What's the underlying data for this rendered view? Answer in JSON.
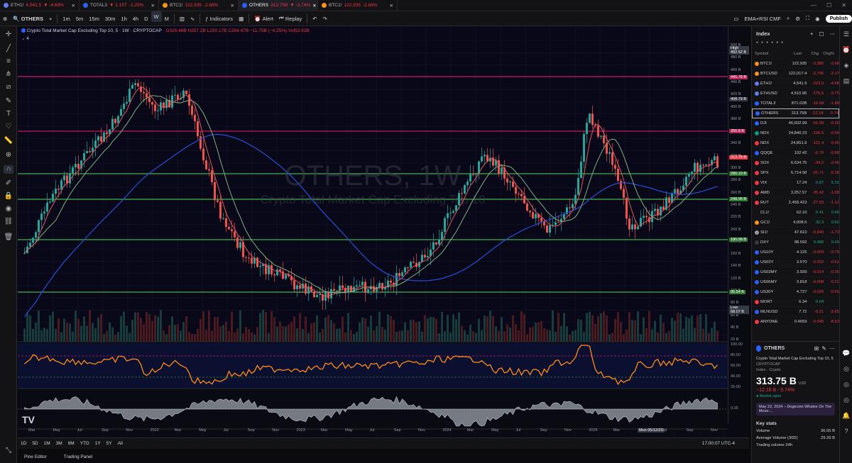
{
  "tabs": [
    {
      "symbol": "ETH1!",
      "text": "4,541.5",
      "chg": "▼ -4.68%",
      "active": false,
      "color": "#627eea"
    },
    {
      "symbol": "TOTAL3",
      "text": "▼ 1.15T",
      "chg": "-1.25%",
      "active": false,
      "color": "#2962ff"
    },
    {
      "symbol": "BTC1!",
      "text": "122,935",
      "chg": "-2.68%",
      "active": false,
      "color": "#f7931a"
    },
    {
      "symbol": "OTHERS",
      "text": "313.75B",
      "chg": "▼ -3.74%",
      "active": true,
      "color": "#2962ff"
    },
    {
      "symbol": "BTC1!",
      "text": "122,935",
      "chg": "-2.68%",
      "active": false,
      "color": "#f7931a"
    }
  ],
  "toolbar": {
    "symbol": "OTHERS",
    "intervals": [
      "1m",
      "5m",
      "15m",
      "30m",
      "1h",
      "4h",
      "D",
      "W",
      "M"
    ],
    "selected_interval": "W",
    "indicators": "Indicators",
    "alert": "Alert",
    "replay": "Replay",
    "study_label": "EMA+RSI CMF",
    "publish": "Publish"
  },
  "legend": {
    "title": "Crypto Total Market Cap Excluding Top 10, 5 · 1W · CRYPTOCAP",
    "ohlc": "O326.48B H297.2B L250.17B C264.47B −11.75B (−4.25%) Vol53.93B",
    "count": "4"
  },
  "watermark": {
    "symbol": "OTHERS, 1W",
    "desc": "Crypto Total Market Cap Excluding Top 10"
  },
  "price_axis": {
    "ticks": [
      "500 B",
      "480 B",
      "460 B",
      "440 B",
      "420 B",
      "400 B",
      "380 B",
      "360 B",
      "340 B",
      "320 B",
      "300 B",
      "280 B",
      "260 B",
      "240 B",
      "220 B",
      "200 B",
      "180 B",
      "160 B",
      "140 B",
      "120 B",
      "100 B",
      "80 B",
      "60 B",
      "40 B",
      "20 B"
    ],
    "labels": [
      {
        "text": "High",
        "sub": "492.52 B",
        "color": "#363a45"
      },
      {
        "text": "445.78 B",
        "color": "#b2265a"
      },
      {
        "text": "408.79 B",
        "color": "#363a45"
      },
      {
        "text": "356.8 B",
        "color": "#b2265a"
      },
      {
        "text": "313.75 B",
        "color": "#f23645"
      },
      {
        "text": "286.19 B",
        "color": "#2e7d32"
      },
      {
        "text": "248.06 B",
        "color": "#2e7d32"
      },
      {
        "text": "180.98 B",
        "color": "#2e7d32"
      },
      {
        "text": "95.54 B",
        "color": "#2e7d32"
      },
      {
        "text": "Low",
        "sub": "68.07 B",
        "color": "#363a45"
      }
    ],
    "rsi_ticks": [
      "100.00",
      "80.00",
      "60.00",
      "40.00",
      "20.00"
    ],
    "cmf_ticks": [
      "0.00"
    ]
  },
  "x_axis": [
    "Mar",
    "May",
    "Jul",
    "Sep",
    "Nov",
    "2022",
    "Mar",
    "May",
    "Jul",
    "Sep",
    "Nov",
    "2023",
    "Mar",
    "May",
    "Jul",
    "Sep",
    "Nov",
    "2024",
    "Mar",
    "May",
    "Jul",
    "Sep",
    "Nov",
    "2025",
    "Mar",
    "Mon 05/12/25",
    "Jul",
    "Sep",
    "Nov"
  ],
  "bottom_bar": {
    "ranges": [
      "1D",
      "5D",
      "1M",
      "3M",
      "6M",
      "YTD",
      "1Y",
      "5Y",
      "All"
    ],
    "time": "17:00:07 UTC-4",
    "pine": "Pine Editor",
    "panel": "Trading Panel"
  },
  "watchlist": {
    "title": "Index",
    "columns": [
      "Symbol",
      "Last",
      "Chg",
      "Chg%"
    ],
    "rows": [
      {
        "sym": "BTC1!",
        "last": "122,935",
        "chg": "-3,380",
        "pct": "-2.68",
        "color": "#f7931a",
        "up": false
      },
      {
        "sym": "BTCUSD",
        "last": "122,017.4",
        "chg": "-2,706",
        "pct": "-2.17",
        "color": "#f7931a",
        "up": false
      },
      {
        "sym": "ETH1!",
        "last": "4,541.5",
        "chg": "-223.0",
        "pct": "-4.68",
        "color": "#627eea",
        "up": false
      },
      {
        "sym": "ETHUSD",
        "last": "4,510.95",
        "chg": "-175.5",
        "pct": "-3.75",
        "color": "#627eea",
        "up": false
      },
      {
        "sym": "TOTAL3",
        "last": "871.02B",
        "chg": "-16.68",
        "pct": "-1.88",
        "color": "#2962ff",
        "up": false
      },
      {
        "sym": "OTHERS",
        "last": "313.75B",
        "chg": "-12.18",
        "pct": "-3.74",
        "color": "#2962ff",
        "up": false,
        "active": true
      },
      {
        "sym": "DJI",
        "last": "46,602.99",
        "chg": "-91.99",
        "pct": "-0.20",
        "color": "#2962ff",
        "up": false
      },
      {
        "sym": "NDX",
        "last": "24,840.23",
        "chg": "-136.5",
        "pct": "-0.55",
        "color": "#089981",
        "up": false
      },
      {
        "sym": "NDX",
        "last": "24,851.9",
        "chg": "-121.4",
        "pct": "-0.49",
        "color": "#f23645",
        "up": false
      },
      {
        "sym": "QQQE",
        "last": "102.42",
        "chg": "-0.70",
        "pct": "-0.68",
        "color": "#2962ff",
        "up": false
      },
      {
        "sym": "SOX",
        "last": "6,634.75",
        "chg": "-39.2",
        "pct": "-2.06",
        "color": "#f23645",
        "up": false
      },
      {
        "sym": "SPX",
        "last": "6,714.58",
        "chg": "-25.71",
        "pct": "-0.38",
        "color": "#f23645",
        "up": false
      },
      {
        "sym": "VIX",
        "last": "17.24",
        "chg": "0.87",
        "pct": "5.31",
        "color": "#f23645",
        "up": true
      },
      {
        "sym": "AMD",
        "last": "3,257.57",
        "chg": "-35.42",
        "pct": "-1.08",
        "color": "#f23645",
        "up": false
      },
      {
        "sym": "RUT",
        "last": "2,458.423",
        "chg": "-27.93",
        "pct": "-1.12",
        "color": "#f23645",
        "up": false
      },
      {
        "sym": "CL1!",
        "last": "62.10",
        "chg": "0.41",
        "pct": "0.66",
        "color": "#131316",
        "up": true
      },
      {
        "sym": "GC1!",
        "last": "4,008.6",
        "chg": "32.3",
        "pct": "0.81",
        "color": "#f7931a",
        "up": true
      },
      {
        "sym": "SI1!",
        "last": "47.610",
        "chg": "-0.840",
        "pct": "-1.73",
        "color": "#9598a1",
        "up": false
      },
      {
        "sym": "DXY",
        "last": "98.592",
        "chg": "0.480",
        "pct": "0.49",
        "color": "#363a45",
        "up": true
      },
      {
        "sym": "US10Y",
        "last": "4.125",
        "chg": "-0.003",
        "pct": "-0.79",
        "color": "#2962ff",
        "up": false
      },
      {
        "sym": "US02Y",
        "last": "3.570",
        "chg": "-0.022",
        "pct": "-0.61",
        "color": "#2962ff",
        "up": false
      },
      {
        "sym": "US03MY",
        "last": "3.939",
        "chg": "-0.014",
        "pct": "-0.35",
        "color": "#2962ff",
        "up": false
      },
      {
        "sym": "US06MY",
        "last": "3.818",
        "chg": "-0.008",
        "pct": "-0.21",
        "color": "#2962ff",
        "up": false
      },
      {
        "sym": "US30Y",
        "last": "4.727",
        "chg": "-0.026",
        "pct": "-0.55",
        "color": "#2962ff",
        "up": false
      },
      {
        "sym": "MORT",
        "last": "6.34",
        "chg": "0.04",
        "pct": "",
        "color": "#f23645",
        "up": true
      },
      {
        "sym": "MLNUSD",
        "last": "7.72",
        "chg": "-0.21",
        "pct": "-2.65",
        "color": "#2962ff",
        "up": false
      },
      {
        "sym": "ANYONE",
        "last": "0.4659",
        "chg": "-0.045",
        "pct": "-8.93",
        "color": "#f23645",
        "up": false
      }
    ]
  },
  "details": {
    "symbol": "OTHERS",
    "name": "Crypto Total Market Cap Excluding Top 10, 5",
    "source": "CRYPTOCAP",
    "category": "Index · Crypto",
    "price": "313.75 B",
    "currency": "USD",
    "change": "−12.18 B  −3.74%",
    "status": "● Market open",
    "news": "May 22, 2024 – Dogecoin Whales On The Move:...",
    "key_stats": "Key stats",
    "stats": [
      {
        "k": "Volume",
        "v": "36.55 B"
      },
      {
        "k": "Average Volume (30D)",
        "v": "29.29 B"
      },
      {
        "k": "Trading volume 24h",
        "v": ""
      }
    ]
  }
}
